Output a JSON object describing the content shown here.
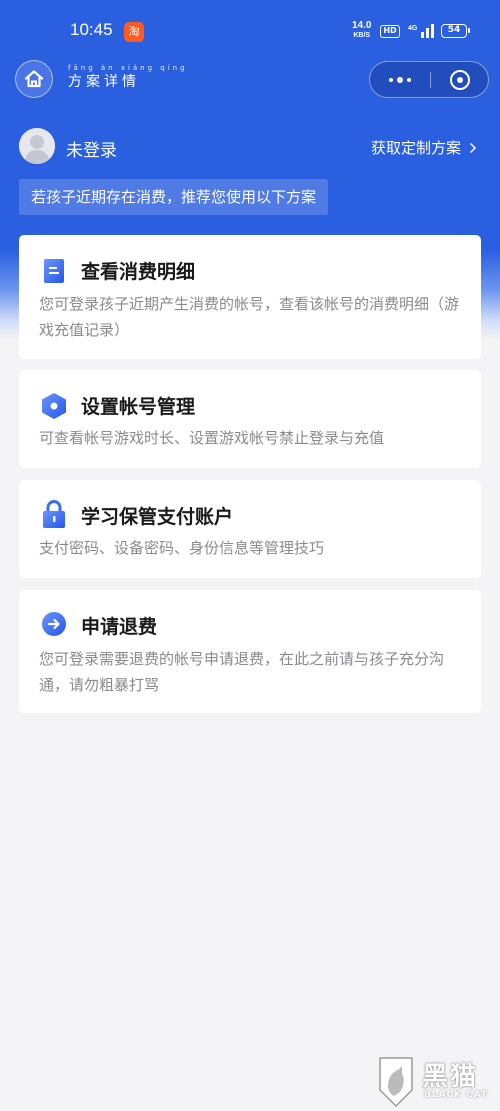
{
  "status_bar": {
    "time": "10:45",
    "taobao_icon": "淘",
    "net_speed_value": "14.0",
    "net_speed_unit": "KB/S",
    "hd_badge": "HD",
    "network": "4G",
    "battery": "54"
  },
  "navbar": {
    "title_pinyin": "fāng àn xiáng qíng",
    "title": "方案详情",
    "icons": [
      "home-icon",
      "more-icon",
      "close-icon"
    ]
  },
  "user": {
    "status": "未登录",
    "custom_plan_label": "获取定制方案"
  },
  "notice": "若孩子近期存在消费，推荐您使用以下方案",
  "cards": [
    {
      "icon": "document-icon",
      "title": "查看消费明细",
      "desc": "您可登录孩子近期产生消费的帐号，查看该帐号的消费明细（游戏充值记录）"
    },
    {
      "icon": "hexagon-settings-icon",
      "title": "设置帐号管理",
      "desc": "可查看帐号游戏时长、设置游戏帐号禁止登录与充值"
    },
    {
      "icon": "lock-icon",
      "title": "学习保管支付账户",
      "desc": "支付密码、设备密码、身份信息等管理技巧"
    },
    {
      "icon": "arrow-circle-icon",
      "title": "申请退费",
      "desc": "您可登录需要退费的帐号申请退费，在此之前请与孩子充分沟通，请勿粗暴打骂"
    }
  ],
  "watermark": {
    "cn": "黑猫",
    "en": "BLACK CAT"
  },
  "colors": {
    "brand_blue": "#2a5fe0",
    "icon_blue": "#3a6ff0",
    "page_bg": "#f4f4f6"
  }
}
